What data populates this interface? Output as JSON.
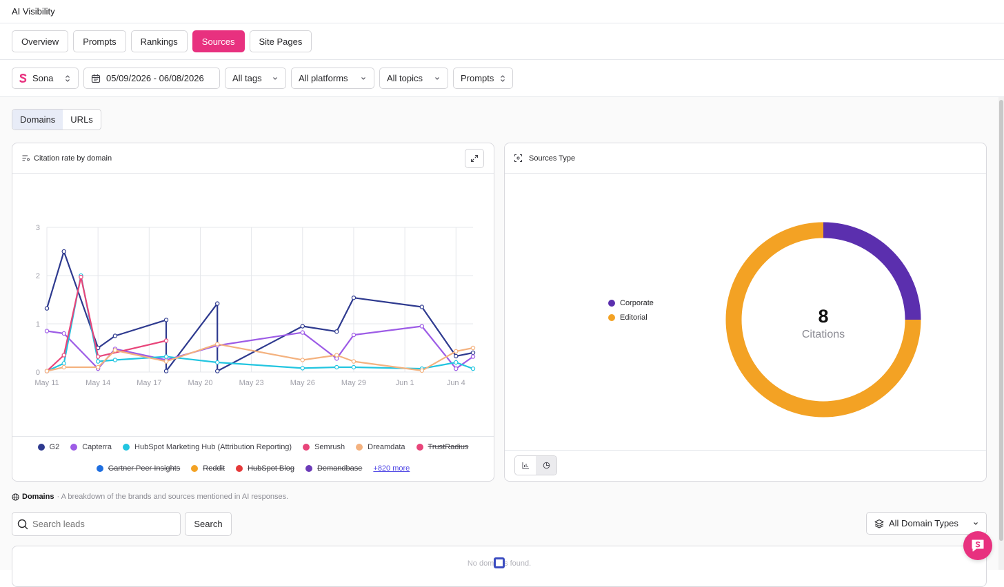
{
  "app": {
    "title": "AI Visibility"
  },
  "tabs": [
    {
      "label": "Overview",
      "active": false
    },
    {
      "label": "Prompts",
      "active": false
    },
    {
      "label": "Rankings",
      "active": false
    },
    {
      "label": "Sources",
      "active": true
    },
    {
      "label": "Site Pages",
      "active": false
    }
  ],
  "filters": {
    "brand": "Sona",
    "date_range": "05/09/2026 - 06/08/2026",
    "tags": "All tags",
    "platforms": "All platforms",
    "topics": "All topics",
    "mode": "Prompts"
  },
  "view_toggle": {
    "domains": "Domains",
    "urls": "URLs",
    "selected": "Domains"
  },
  "citation_card": {
    "title": "Citation rate by domain",
    "more_link": "+820 more"
  },
  "sources_card": {
    "title": "Sources Type",
    "total_value": "8",
    "total_label": "Citations"
  },
  "domains_section": {
    "title": "Domains",
    "description": "· A breakdown of the brands and sources mentioned in AI responses."
  },
  "search": {
    "placeholder": "Search leads",
    "button": "Search"
  },
  "domain_type_filter": "All Domain Types",
  "table": {
    "empty_message": "No domains found."
  },
  "colors": {
    "accent": "#e8317f",
    "corporate": "#5b2fae",
    "editorial": "#f3a224"
  },
  "chart_data": [
    {
      "type": "line",
      "title": "Citation rate by domain",
      "ylim": [
        0,
        3
      ],
      "y_ticks": [
        "0",
        "1",
        "2",
        "3"
      ],
      "x_ticks": [
        "May 11",
        "May 14",
        "May 17",
        "May 20",
        "May 23",
        "May 26",
        "May 29",
        "Jun 1",
        "Jun 4"
      ],
      "grid": true,
      "series": [
        {
          "name": "G2",
          "color": "#2e3a8f",
          "hidden": false,
          "points": [
            [
              0,
              1.32
            ],
            [
              1,
              2.5
            ],
            [
              3,
              0.5
            ],
            [
              4,
              0.75
            ],
            [
              7,
              1.08
            ],
            [
              7,
              0.02
            ],
            [
              10,
              1.42
            ],
            [
              10,
              0.02
            ],
            [
              15,
              0.95
            ],
            [
              17,
              0.84
            ],
            [
              18,
              1.54
            ],
            [
              22,
              1.35
            ],
            [
              24,
              0.33
            ],
            [
              25,
              0.4
            ]
          ]
        },
        {
          "name": "Capterra",
          "color": "#9d5ce6",
          "hidden": false,
          "points": [
            [
              0,
              0.85
            ],
            [
              1,
              0.8
            ],
            [
              3,
              0.07
            ],
            [
              4,
              0.48
            ],
            [
              7,
              0.25
            ],
            [
              10,
              0.55
            ],
            [
              15,
              0.82
            ],
            [
              17,
              0.28
            ],
            [
              18,
              0.77
            ],
            [
              22,
              0.95
            ],
            [
              24,
              0.07
            ],
            [
              25,
              0.32
            ]
          ]
        },
        {
          "name": "HubSpot Marketing Hub (Attribution Reporting)",
          "color": "#22c5e0",
          "hidden": false,
          "points": [
            [
              0,
              0.02
            ],
            [
              1,
              0.18
            ],
            [
              2,
              2.0
            ],
            [
              3,
              0.22
            ],
            [
              4,
              0.25
            ],
            [
              7,
              0.32
            ],
            [
              10,
              0.2
            ],
            [
              15,
              0.08
            ],
            [
              17,
              0.1
            ],
            [
              18,
              0.1
            ],
            [
              22,
              0.07
            ],
            [
              24,
              0.2
            ],
            [
              25,
              0.07
            ]
          ]
        },
        {
          "name": "Semrush",
          "color": "#e8457a",
          "hidden": false,
          "points": [
            [
              0,
              0.02
            ],
            [
              1,
              0.35
            ],
            [
              2,
              1.97
            ],
            [
              3,
              0.32
            ],
            [
              7,
              0.65
            ]
          ]
        },
        {
          "name": "Dreamdata",
          "color": "#f4b27f",
          "hidden": false,
          "points": [
            [
              0,
              0.02
            ],
            [
              1,
              0.1
            ],
            [
              3,
              0.1
            ],
            [
              4,
              0.45
            ],
            [
              7,
              0.22
            ],
            [
              10,
              0.58
            ],
            [
              15,
              0.25
            ],
            [
              17,
              0.35
            ],
            [
              18,
              0.22
            ],
            [
              22,
              0.03
            ],
            [
              24,
              0.43
            ],
            [
              25,
              0.5
            ]
          ]
        },
        {
          "name": "TrustRadius",
          "color": "#e8457a",
          "hidden": true,
          "points": []
        },
        {
          "name": "Gartner Peer Insights",
          "color": "#1f6fe0",
          "hidden": true,
          "points": []
        },
        {
          "name": "Reddit",
          "color": "#f3a224",
          "hidden": true,
          "points": []
        },
        {
          "name": "HubSpot Blog",
          "color": "#e53939",
          "hidden": true,
          "points": []
        },
        {
          "name": "Demandbase",
          "color": "#6c3bb8",
          "hidden": true,
          "points": []
        }
      ]
    },
    {
      "type": "pie",
      "title": "Sources Type",
      "donut": true,
      "center_value": 8,
      "center_label": "Citations",
      "slices": [
        {
          "name": "Corporate",
          "value": 2,
          "color": "#5b2fae"
        },
        {
          "name": "Editorial",
          "value": 6,
          "color": "#f3a224"
        }
      ]
    }
  ]
}
